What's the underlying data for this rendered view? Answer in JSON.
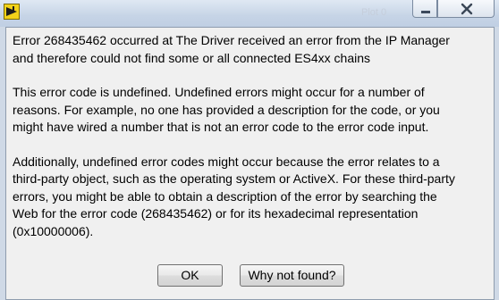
{
  "titlebar": {
    "background_text": "Plot 0",
    "icons": {
      "app": "labview-warning-icon",
      "minimize": "minimize-icon",
      "close": "close-icon"
    }
  },
  "dialog": {
    "paragraphs": [
      "Error 268435462 occurred at The Driver received an error from the IP Manager\nand therefore could not find some or all connected ES4xx chains",
      "This error code is undefined. Undefined errors might occur for a number of\nreasons. For example, no one has provided a description for the code, or you\nmight have wired a number that is not an error code to the error code input.",
      "Additionally, undefined error codes might occur because the error relates to a\nthird-party object, such as the operating system or ActiveX. For these third-party\nerrors, you might be able to obtain a description of the error by searching the\nWeb for the error code (268435462) or for its hexadecimal representation\n(0x10000006)."
    ],
    "buttons": {
      "ok": "OK",
      "why_not_found": "Why not found?"
    }
  },
  "colors": {
    "titlebar": "#c6d4e6",
    "client": "#f0f0f0",
    "button_border": "#707070"
  }
}
